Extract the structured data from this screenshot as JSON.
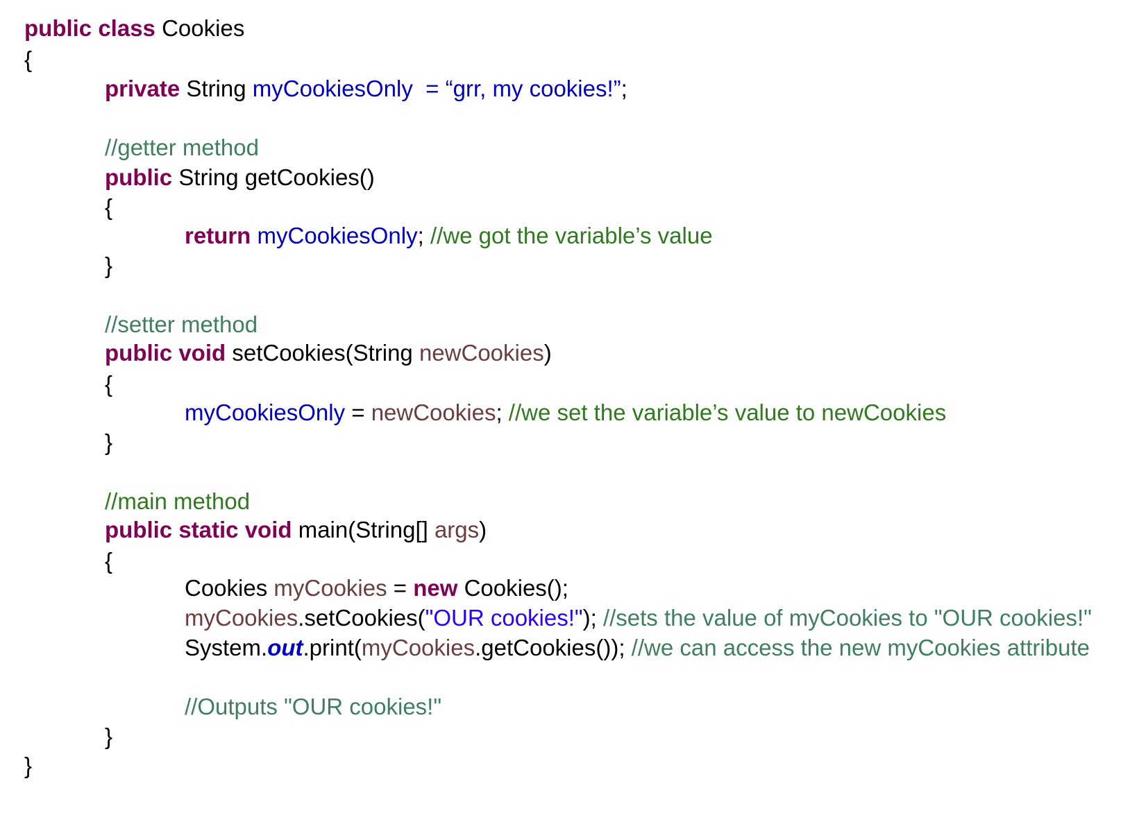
{
  "lines": [
    [
      {
        "text": "public class",
        "type": "kw"
      },
      {
        "text": " Cookies",
        "type": "plain"
      }
    ],
    [
      {
        "text": "{",
        "type": "plain"
      }
    ],
    [
      {
        "text": "private",
        "type": "kw"
      },
      {
        "text": " String ",
        "type": "plain"
      },
      {
        "text": "myCookiesOnly  = “grr, my cookies!”",
        "type": "field"
      },
      {
        "text": ";",
        "type": "plain"
      }
    ],
    [
      {
        "text": "//getter method",
        "type": "comment"
      }
    ],
    [
      {
        "text": "public",
        "type": "kw"
      },
      {
        "text": " String getCookies()",
        "type": "plain"
      }
    ],
    [
      {
        "text": "{",
        "type": "plain"
      }
    ],
    [
      {
        "text": "return",
        "type": "kw"
      },
      {
        "text": " ",
        "type": "plain"
      },
      {
        "text": "myCookiesOnly",
        "type": "field"
      },
      {
        "text": "; ",
        "type": "plain"
      },
      {
        "text": "//we got the variable’s value",
        "type": "comment2"
      }
    ],
    [
      {
        "text": "}",
        "type": "plain"
      }
    ],
    [
      {
        "text": "//setter method",
        "type": "comment"
      }
    ],
    [
      {
        "text": "public void",
        "type": "kw"
      },
      {
        "text": " setCookies(String ",
        "type": "plain"
      },
      {
        "text": "newCookies",
        "type": "local"
      },
      {
        "text": ")",
        "type": "plain"
      }
    ],
    [
      {
        "text": "{",
        "type": "plain"
      }
    ],
    [
      {
        "text": "myCookiesOnly",
        "type": "field"
      },
      {
        "text": " = ",
        "type": "plain"
      },
      {
        "text": "newCookies",
        "type": "local"
      },
      {
        "text": "; ",
        "type": "plain"
      },
      {
        "text": "//we set the variable’s value to newCookies",
        "type": "comment2"
      }
    ],
    [
      {
        "text": "}",
        "type": "plain"
      }
    ],
    [
      {
        "text": "//main method",
        "type": "comment2"
      }
    ],
    [
      {
        "text": "public static void",
        "type": "kw"
      },
      {
        "text": " main(String[] ",
        "type": "plain"
      },
      {
        "text": "args",
        "type": "local"
      },
      {
        "text": ")",
        "type": "plain"
      }
    ],
    [
      {
        "text": "{",
        "type": "plain"
      }
    ],
    [
      {
        "text": "Cookies ",
        "type": "plain"
      },
      {
        "text": "myCookies",
        "type": "local"
      },
      {
        "text": " = ",
        "type": "plain"
      },
      {
        "text": "new",
        "type": "kw"
      },
      {
        "text": " Cookies();",
        "type": "plain"
      }
    ],
    [
      {
        "text": "myCookies",
        "type": "local"
      },
      {
        "text": ".setCookies(",
        "type": "plain"
      },
      {
        "text": "\"OUR cookies!\"",
        "type": "str"
      },
      {
        "text": "); ",
        "type": "plain"
      },
      {
        "text": "//sets the value of myCookies to \"OUR cookies!\"",
        "type": "comment"
      }
    ],
    [
      {
        "text": "System.",
        "type": "plain"
      },
      {
        "text": "out",
        "type": "static"
      },
      {
        "text": ".print(",
        "type": "plain"
      },
      {
        "text": "myCookies",
        "type": "local"
      },
      {
        "text": ".getCookies()); ",
        "type": "plain"
      },
      {
        "text": "//we can access the new myCookies attribute",
        "type": "comment"
      }
    ],
    [
      {
        "text": "//Outputs \"OUR cookies!\"",
        "type": "comment"
      }
    ],
    [
      {
        "text": "}",
        "type": "plain"
      }
    ],
    [
      {
        "text": "}",
        "type": "plain"
      }
    ]
  ]
}
